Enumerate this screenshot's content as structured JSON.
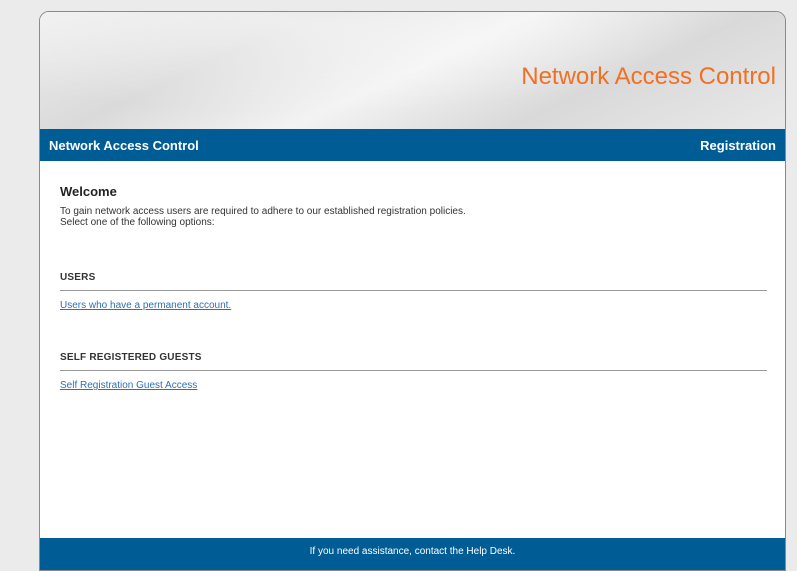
{
  "banner": {
    "title": "Network Access Control"
  },
  "navbar": {
    "left_title": "Network Access Control",
    "right_title": "Registration"
  },
  "main": {
    "heading": "Welcome",
    "intro_lines": [
      "To gain network access users are required to adhere to our established registration policies.",
      "Select one of the following options:"
    ],
    "sections": [
      {
        "heading": "USERS",
        "link_text": "Users who have a permanent account."
      },
      {
        "heading": "SELF REGISTERED GUESTS",
        "link_text": "Self Registration Guest Access"
      }
    ]
  },
  "footer": {
    "text": "If you need assistance, contact the Help Desk."
  },
  "colors": {
    "brand_blue": "#005c94",
    "title_orange": "#f36f21",
    "link_blue": "#2f6fb3"
  }
}
